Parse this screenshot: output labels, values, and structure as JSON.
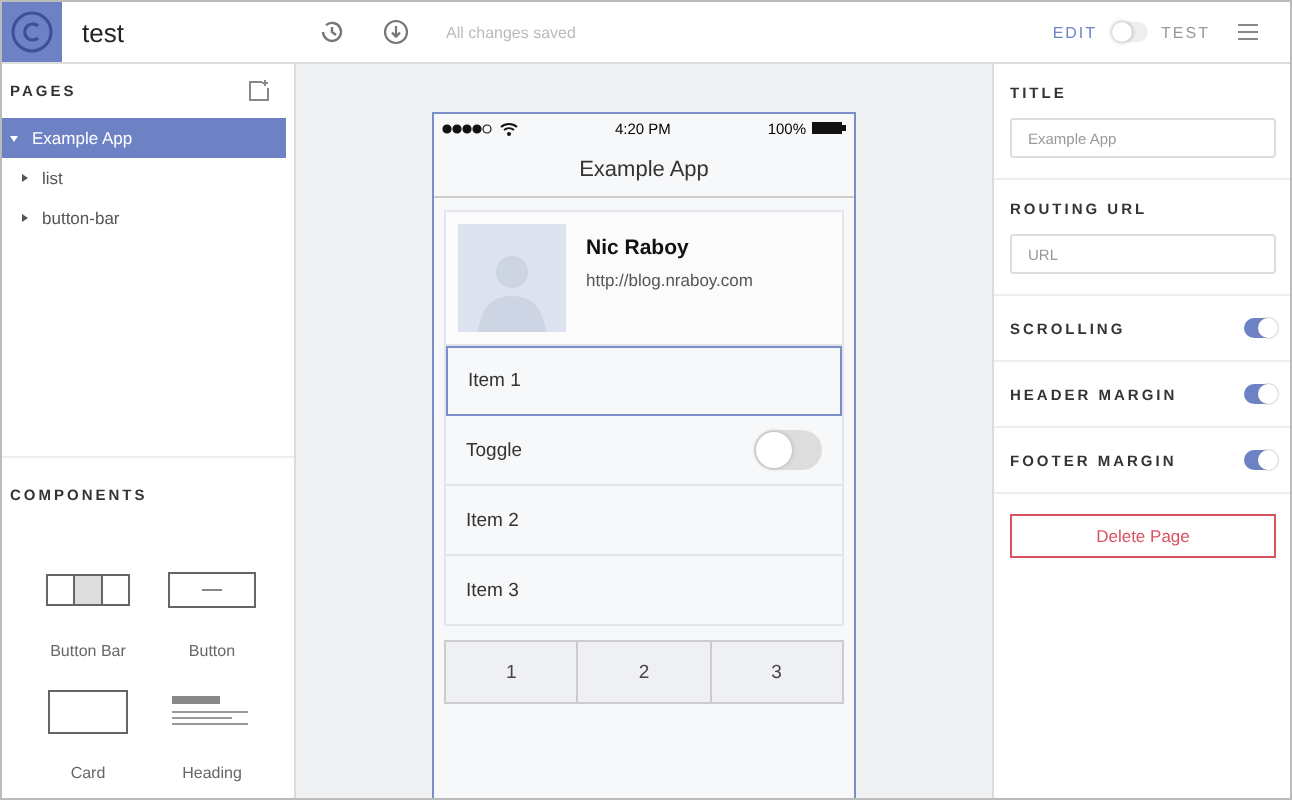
{
  "toolbar": {
    "title": "test",
    "status": "All changes saved",
    "mode_switch_on": false,
    "modes": [
      {
        "label": "EDIT",
        "selected": true
      },
      {
        "label": "TEST",
        "selected": false
      }
    ]
  },
  "pages": {
    "title": "PAGES",
    "items": [
      {
        "label": "Example App",
        "selected": true,
        "expanded": true,
        "children": [
          {
            "label": "list",
            "selected": false,
            "expanded": false
          },
          {
            "label": "button-bar",
            "selected": false,
            "expanded": false
          }
        ]
      }
    ]
  },
  "components": {
    "title": "COMPONENTS",
    "items": [
      {
        "kind": "buttonbar",
        "label": "Button Bar"
      },
      {
        "kind": "button",
        "label": "Button"
      },
      {
        "kind": "card",
        "label": "Card"
      },
      {
        "kind": "heading",
        "label": "Heading"
      }
    ]
  },
  "phone": {
    "time": "4:20 PM",
    "battery": "100%",
    "nav_title": "Example App",
    "profile": {
      "name": "Nic Raboy",
      "url": "http://blog.nraboy.com"
    },
    "list": [
      {
        "kind": "item",
        "label": "Item 1",
        "selected": true
      },
      {
        "kind": "toggle",
        "label": "Toggle",
        "selected": false,
        "on": false
      },
      {
        "kind": "item",
        "label": "Item 2",
        "selected": false
      },
      {
        "kind": "item",
        "label": "Item 3",
        "selected": false
      }
    ],
    "button_bar": [
      "1",
      "2",
      "3"
    ]
  },
  "properties": {
    "fields": [
      {
        "label": "TITLE",
        "placeholder": "Example App"
      },
      {
        "label": "ROUTING URL",
        "placeholder": "URL"
      }
    ],
    "switches": [
      {
        "label": "SCROLLING",
        "on": true
      },
      {
        "label": "HEADER MARGIN",
        "on": true
      },
      {
        "label": "FOOTER MARGIN",
        "on": true
      }
    ],
    "delete_button": "Delete Page"
  }
}
